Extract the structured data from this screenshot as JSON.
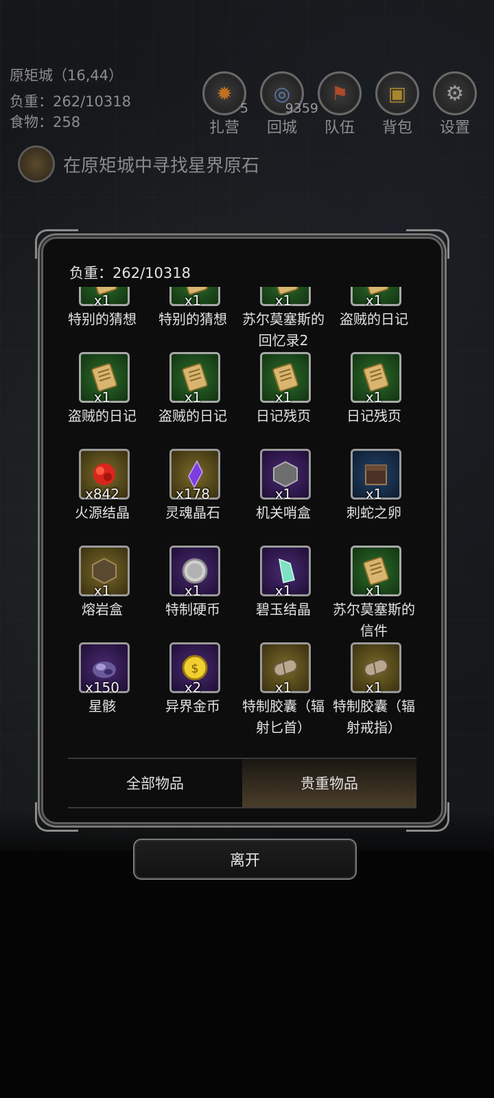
{
  "hud": {
    "location": "原矩城（16,44）",
    "load": "负重：262/10318",
    "food": "食物：258",
    "buttons": [
      {
        "label": "扎营",
        "badge": "5",
        "icon": "campfire-icon"
      },
      {
        "label": "回城",
        "badge": "9359",
        "icon": "portal-icon"
      },
      {
        "label": "队伍",
        "badge": "",
        "icon": "team-icon"
      },
      {
        "label": "背包",
        "badge": "",
        "icon": "backpack-icon"
      },
      {
        "label": "设置",
        "badge": "",
        "icon": "gear-icon"
      }
    ]
  },
  "quest": {
    "text": "在原矩城中寻找星界原石",
    "icon": "quest-scroll-icon"
  },
  "inventory": {
    "load": "负重：262/10318",
    "items": [
      {
        "name": "特别的猜想",
        "qty": "x1",
        "rarity": "green",
        "icon": "scroll-icon"
      },
      {
        "name": "特别的猜想",
        "qty": "x1",
        "rarity": "green",
        "icon": "scroll-icon"
      },
      {
        "name": "苏尔莫塞斯的回忆录2",
        "qty": "x1",
        "rarity": "green",
        "icon": "scroll-icon"
      },
      {
        "name": "盗贼的日记",
        "qty": "x1",
        "rarity": "green",
        "icon": "scroll-icon"
      },
      {
        "name": "盗贼的日记",
        "qty": "x1",
        "rarity": "green",
        "icon": "scroll-icon"
      },
      {
        "name": "盗贼的日记",
        "qty": "x1",
        "rarity": "green",
        "icon": "scroll-icon"
      },
      {
        "name": "日记残页",
        "qty": "x1",
        "rarity": "green",
        "icon": "scroll-icon"
      },
      {
        "name": "日记残页",
        "qty": "x1",
        "rarity": "green",
        "icon": "scroll-icon"
      },
      {
        "name": "火源结晶",
        "qty": "x842",
        "rarity": "gold",
        "icon": "fire-crystal-icon"
      },
      {
        "name": "灵魂晶石",
        "qty": "x178",
        "rarity": "gold",
        "icon": "soul-crystal-icon"
      },
      {
        "name": "机关哨盒",
        "qty": "x1",
        "rarity": "purple",
        "icon": "mechanism-box-icon"
      },
      {
        "name": "刺蛇之卵",
        "qty": "x1",
        "rarity": "blue",
        "icon": "egg-box-icon"
      },
      {
        "name": "熔岩盒",
        "qty": "x1",
        "rarity": "gold",
        "icon": "lava-box-icon"
      },
      {
        "name": "特制硬币",
        "qty": "x1",
        "rarity": "purple",
        "icon": "coin-icon"
      },
      {
        "name": "碧玉结晶",
        "qty": "x1",
        "rarity": "purple",
        "icon": "jade-crystal-icon"
      },
      {
        "name": "苏尔莫塞斯的信件",
        "qty": "x1",
        "rarity": "green",
        "icon": "scroll-icon"
      },
      {
        "name": "星骸",
        "qty": "x150",
        "rarity": "purple",
        "icon": "star-remains-icon"
      },
      {
        "name": "异界金币",
        "qty": "x2",
        "rarity": "purple",
        "icon": "gold-coin-icon"
      },
      {
        "name": "特制胶囊（辐射匕首）",
        "qty": "x1",
        "rarity": "gold",
        "icon": "capsule-icon"
      },
      {
        "name": "特制胶囊（辐射戒指）",
        "qty": "x1",
        "rarity": "gold",
        "icon": "capsule-icon"
      }
    ],
    "tabs": [
      {
        "label": "全部物品",
        "active": false
      },
      {
        "label": "贵重物品",
        "active": true
      }
    ]
  },
  "leave_label": "离开"
}
